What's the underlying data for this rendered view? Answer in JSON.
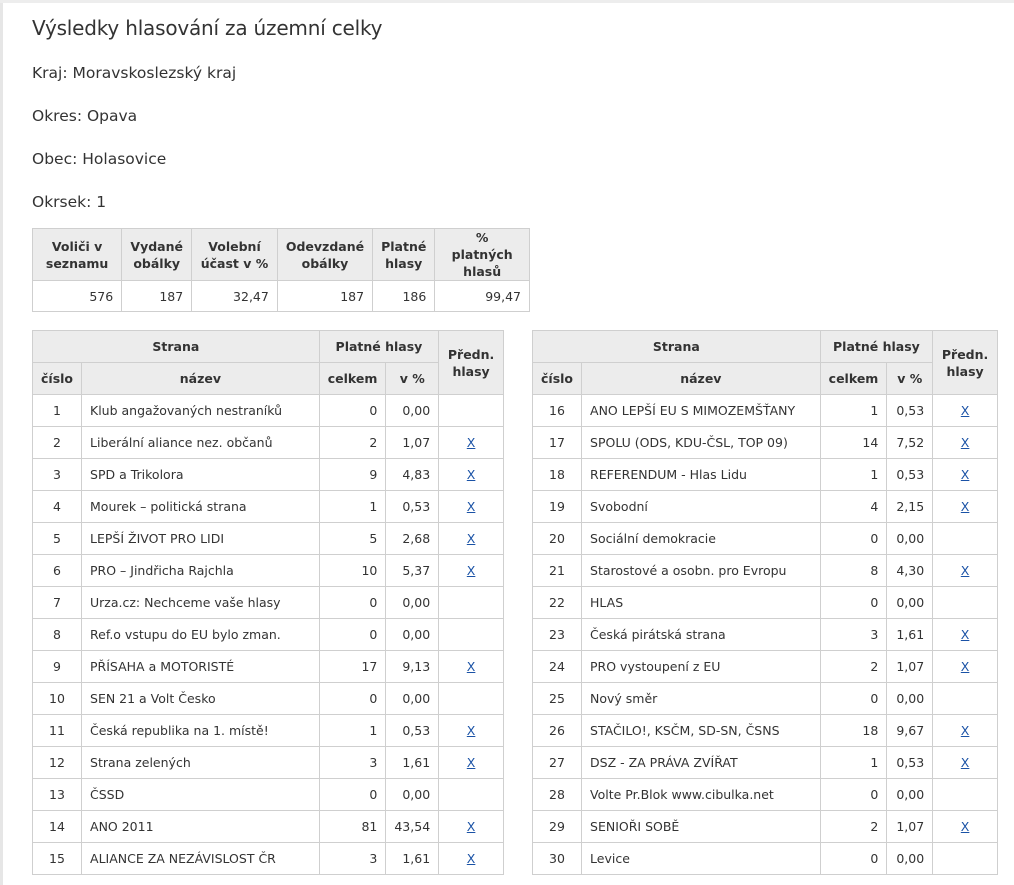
{
  "page": {
    "title": "Výsledky hlasování za územní celky",
    "kraj": "Kraj: Moravskoslezský kraj",
    "okres": "Okres: Opava",
    "obec": "Obec: Holasovice",
    "okrsek": "Okrsek: 1"
  },
  "summary": {
    "headers": {
      "volici": "Voliči v seznamu",
      "obalky": "Vydané obálky",
      "ucast": "Volební účast v %",
      "odevzdane": "Odevzdané obálky",
      "platne": "Platné hlasy",
      "procento": "% platných hlasů"
    },
    "values": {
      "volici": "576",
      "obalky": "187",
      "ucast": "32,47",
      "odevzdane": "187",
      "platne": "186",
      "procento": "99,47"
    }
  },
  "results_headers": {
    "strana": "Strana",
    "platne_hlasy": "Platné hlasy",
    "predn": "Předn. hlasy",
    "cislo": "číslo",
    "nazev": "název",
    "celkem": "celkem",
    "procent": "v %"
  },
  "link_label": "X",
  "results_left": [
    {
      "num": "1",
      "name": "Klub angažovaných nestraníků",
      "votes": "0",
      "pct": "0,00",
      "pref": ""
    },
    {
      "num": "2",
      "name": "Liberální aliance nez. občanů",
      "votes": "2",
      "pct": "1,07",
      "pref": "X"
    },
    {
      "num": "3",
      "name": "SPD a Trikolora",
      "votes": "9",
      "pct": "4,83",
      "pref": "X"
    },
    {
      "num": "4",
      "name": "Mourek – politická strana",
      "votes": "1",
      "pct": "0,53",
      "pref": "X"
    },
    {
      "num": "5",
      "name": "LEPŠÍ ŽIVOT PRO LIDI",
      "votes": "5",
      "pct": "2,68",
      "pref": "X"
    },
    {
      "num": "6",
      "name": "PRO – Jindřicha Rajchla",
      "votes": "10",
      "pct": "5,37",
      "pref": "X"
    },
    {
      "num": "7",
      "name": "Urza.cz: Nechceme vaše hlasy",
      "votes": "0",
      "pct": "0,00",
      "pref": ""
    },
    {
      "num": "8",
      "name": "Ref.o vstupu do EU bylo zman.",
      "votes": "0",
      "pct": "0,00",
      "pref": ""
    },
    {
      "num": "9",
      "name": "PŘÍSAHA a MOTORISTÉ",
      "votes": "17",
      "pct": "9,13",
      "pref": "X"
    },
    {
      "num": "10",
      "name": "SEN 21 a Volt Česko",
      "votes": "0",
      "pct": "0,00",
      "pref": ""
    },
    {
      "num": "11",
      "name": "Česká republika na 1. místě!",
      "votes": "1",
      "pct": "0,53",
      "pref": "X"
    },
    {
      "num": "12",
      "name": "Strana zelených",
      "votes": "3",
      "pct": "1,61",
      "pref": "X"
    },
    {
      "num": "13",
      "name": "ČSSD",
      "votes": "0",
      "pct": "0,00",
      "pref": ""
    },
    {
      "num": "14",
      "name": "ANO 2011",
      "votes": "81",
      "pct": "43,54",
      "pref": "X"
    },
    {
      "num": "15",
      "name": "ALIANCE ZA NEZÁVISLOST ČR",
      "votes": "3",
      "pct": "1,61",
      "pref": "X"
    }
  ],
  "results_right": [
    {
      "num": "16",
      "name": "ANO LEPŠÍ EU S MIMOZEMŠŤANY",
      "votes": "1",
      "pct": "0,53",
      "pref": "X"
    },
    {
      "num": "17",
      "name": "SPOLU (ODS, KDU-ČSL, TOP 09)",
      "votes": "14",
      "pct": "7,52",
      "pref": "X"
    },
    {
      "num": "18",
      "name": "REFERENDUM - Hlas Lidu",
      "votes": "1",
      "pct": "0,53",
      "pref": "X"
    },
    {
      "num": "19",
      "name": "Svobodní",
      "votes": "4",
      "pct": "2,15",
      "pref": "X"
    },
    {
      "num": "20",
      "name": "Sociální demokracie",
      "votes": "0",
      "pct": "0,00",
      "pref": ""
    },
    {
      "num": "21",
      "name": "Starostové a osobn. pro Evropu",
      "votes": "8",
      "pct": "4,30",
      "pref": "X"
    },
    {
      "num": "22",
      "name": "HLAS",
      "votes": "0",
      "pct": "0,00",
      "pref": ""
    },
    {
      "num": "23",
      "name": "Česká pirátská strana",
      "votes": "3",
      "pct": "1,61",
      "pref": "X"
    },
    {
      "num": "24",
      "name": "PRO vystoupení z EU",
      "votes": "2",
      "pct": "1,07",
      "pref": "X"
    },
    {
      "num": "25",
      "name": "Nový směr",
      "votes": "0",
      "pct": "0,00",
      "pref": ""
    },
    {
      "num": "26",
      "name": "STAČILO!, KSČM, SD-SN, ČSNS",
      "votes": "18",
      "pct": "9,67",
      "pref": "X"
    },
    {
      "num": "27",
      "name": "DSZ - ZA PRÁVA ZVÍŘAT",
      "votes": "1",
      "pct": "0,53",
      "pref": "X"
    },
    {
      "num": "28",
      "name": "Volte Pr.Blok www.cibulka.net",
      "votes": "0",
      "pct": "0,00",
      "pref": ""
    },
    {
      "num": "29",
      "name": "SENIOŘI SOBĚ",
      "votes": "2",
      "pct": "1,07",
      "pref": "X"
    },
    {
      "num": "30",
      "name": "Levice",
      "votes": "0",
      "pct": "0,00",
      "pref": ""
    }
  ],
  "colors": {
    "header_bg": "#ececec",
    "border": "#cfcfcf",
    "link": "#1a52a6",
    "text": "#333333"
  }
}
